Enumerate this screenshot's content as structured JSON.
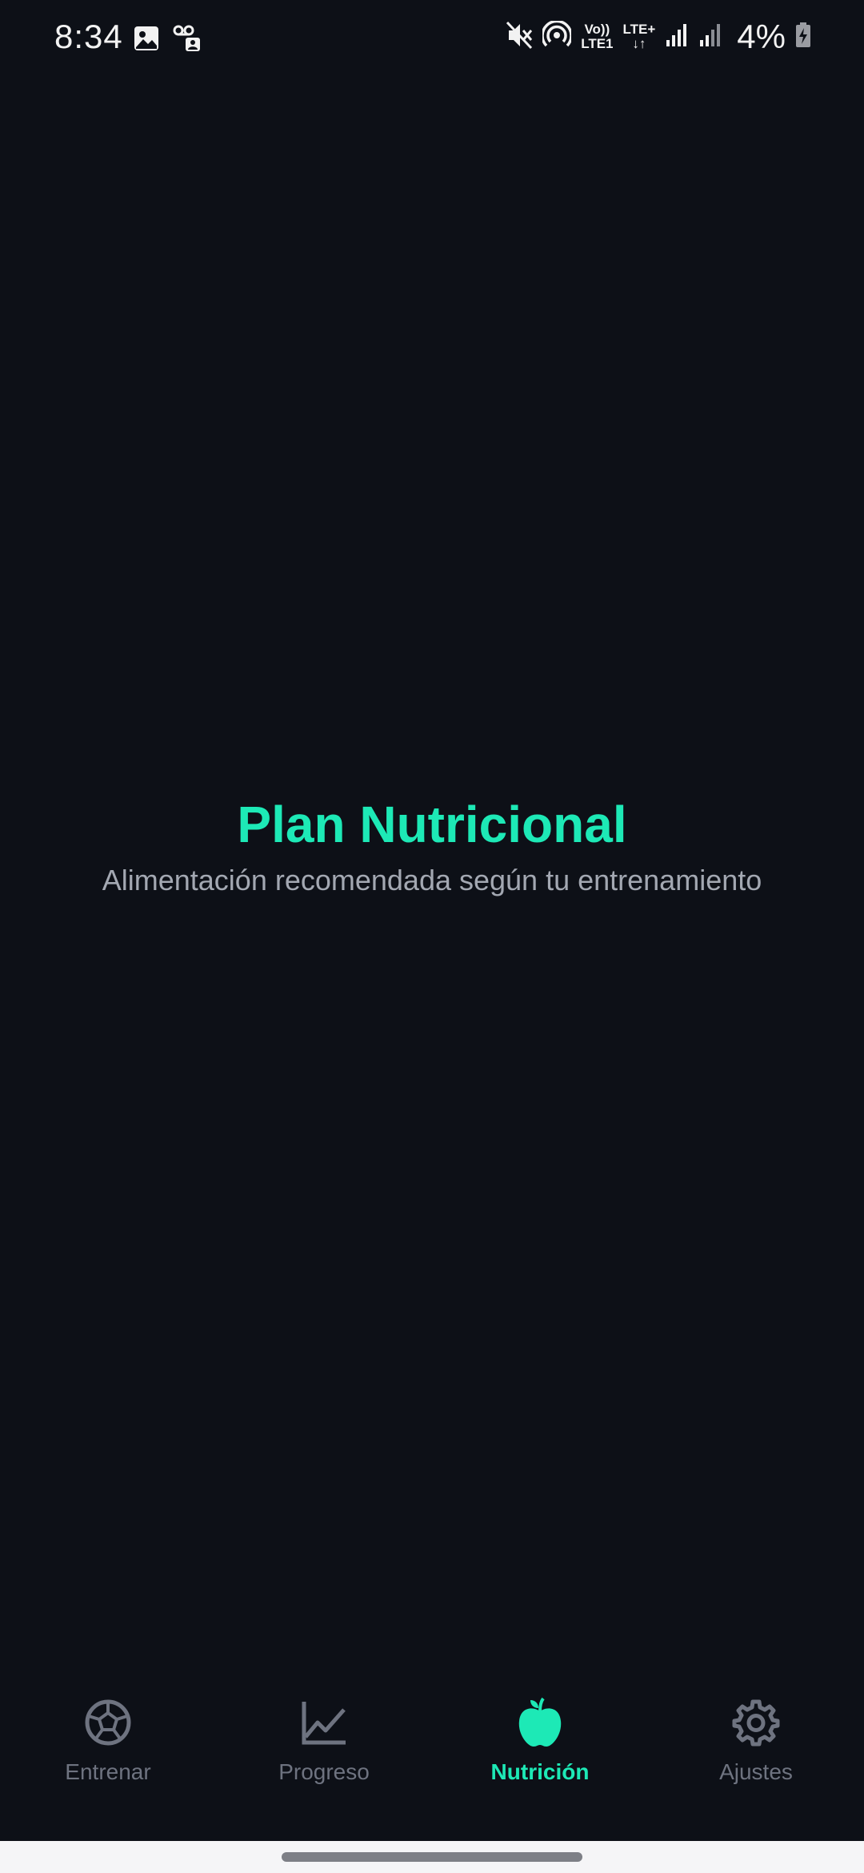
{
  "status_bar": {
    "time": "8:34",
    "left_icons": [
      "image-icon",
      "voicemail-icon"
    ],
    "volte_top": "Vo))",
    "volte_bottom": "LTE1",
    "lte_top": "LTE+",
    "lte_bottom": "↓↑",
    "right_icons": [
      "mute-icon",
      "hotspot-icon",
      "signal-icon",
      "signal-icon-2",
      "battery-charging-icon"
    ],
    "battery": "4%"
  },
  "main": {
    "title": "Plan Nutricional",
    "subtitle": "Alimentación recomendada según tu entrenamiento"
  },
  "bottom_nav": {
    "items": [
      {
        "label": "Entrenar",
        "icon": "soccer-ball-icon",
        "active": false
      },
      {
        "label": "Progreso",
        "icon": "line-chart-icon",
        "active": false
      },
      {
        "label": "Nutrición",
        "icon": "apple-icon",
        "active": true
      },
      {
        "label": "Ajustes",
        "icon": "gear-icon",
        "active": false
      }
    ]
  },
  "colors": {
    "background": "#0d1017",
    "accent": "#1de9b6",
    "inactive": "#6e7380",
    "subtitle": "#a3a8b2"
  }
}
